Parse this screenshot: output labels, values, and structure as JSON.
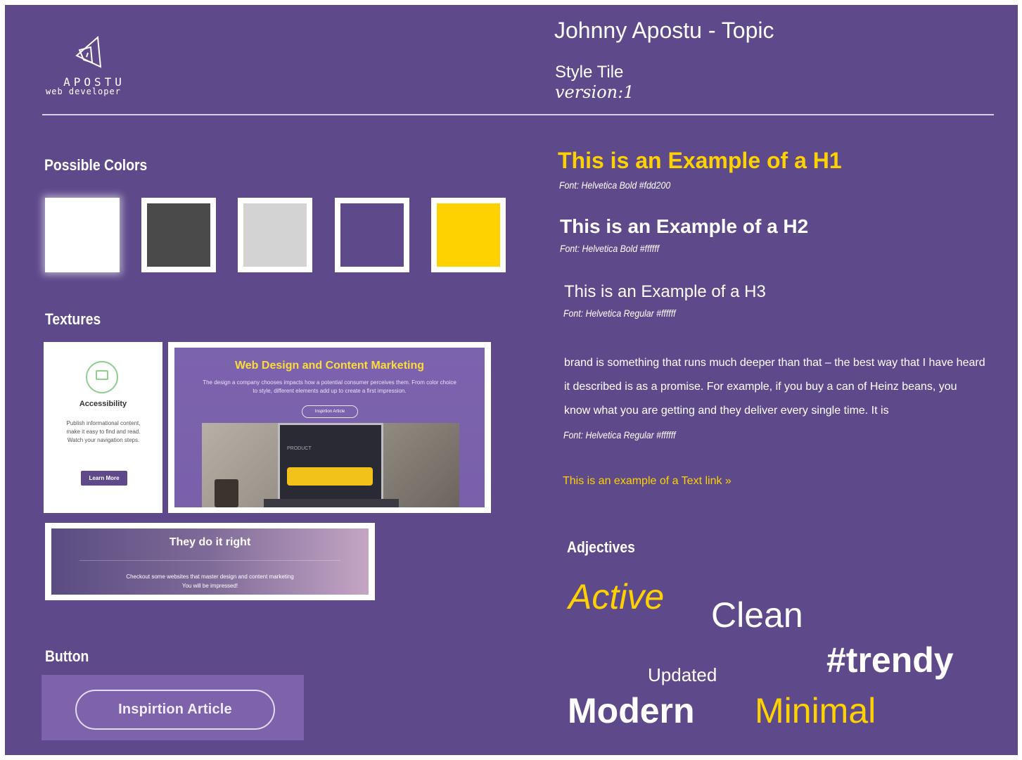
{
  "logo": {
    "brand": "APOSTU",
    "role": "web developer"
  },
  "header": {
    "title": "Johnny Apostu - Topic",
    "subtitle": "Style Tile",
    "version": "version:1"
  },
  "colors": {
    "title": "Possible Colors",
    "swatches": [
      "#ffffff",
      "#4a4a4a",
      "#d3d3d3",
      "#5e4a8b",
      "#fdd200"
    ]
  },
  "textures": {
    "title": "Textures",
    "card1": {
      "heading": "Accessibility",
      "body": "Publish informational content, make it easy to find and read. Watch your navigation steps.",
      "button": "Learn More"
    },
    "card2": {
      "heading": "Web Design and Content Marketing",
      "body": "The design a company chooses impacts how a potential consumer perceives them. From color choice to style, different elements add up to create a first impression.",
      "button": "Inspirtion Article",
      "photo_label": "PRODUCT"
    },
    "card3": {
      "heading": "They do it right",
      "line1": "Checkout some websites that master design and content marketing",
      "line2": "You will be impressed!"
    }
  },
  "button_section": {
    "title": "Button",
    "label": "Inspirtion Article"
  },
  "typography": {
    "h1": "This is an Example of a H1",
    "h1_font": "Font: Helvetica Bold  #fdd200",
    "h2": "This is an Example of a H2",
    "h2_font": "Font: Helvetica Bold #ffffff",
    "h3": "This is an Example of a H3",
    "h3_font": "Font: Helvetica Regular #ffffff",
    "body": "brand is something that runs much deeper than that – the best way that I have heard it described is as a promise. For example, if you buy a can of Heinz beans, you know what you are getting and they deliver every single time. It is",
    "body_font": "Font: Helvetica Regular #ffffff",
    "link": "This is an example of a Text link »"
  },
  "adjectives": {
    "title": "Adjectives",
    "words": [
      "Active",
      "Clean",
      "#trendy",
      "Updated",
      "Modern",
      "Minimal"
    ]
  }
}
